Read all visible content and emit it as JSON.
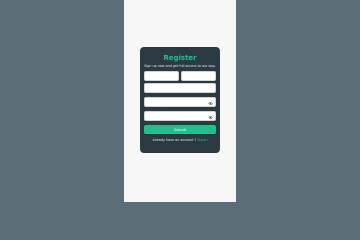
{
  "form": {
    "title": "Register",
    "subtitle": "Sign up now and get full access to our app.",
    "firstname_placeholder": "Firstname",
    "lastname_placeholder": "Lastname",
    "email_placeholder": "Email",
    "password_placeholder": "Password",
    "confirm_password_placeholder": "Confirm password",
    "submit_label": "Submit",
    "signin_prompt": "Already have an account ?",
    "signin_link": "Signin"
  },
  "colors": {
    "background": "#5b6d77",
    "page": "#f7f7f7",
    "card": "#2a3a40",
    "accent": "#22c08a"
  },
  "icons": {
    "password_toggle": "eye-slash-icon"
  }
}
